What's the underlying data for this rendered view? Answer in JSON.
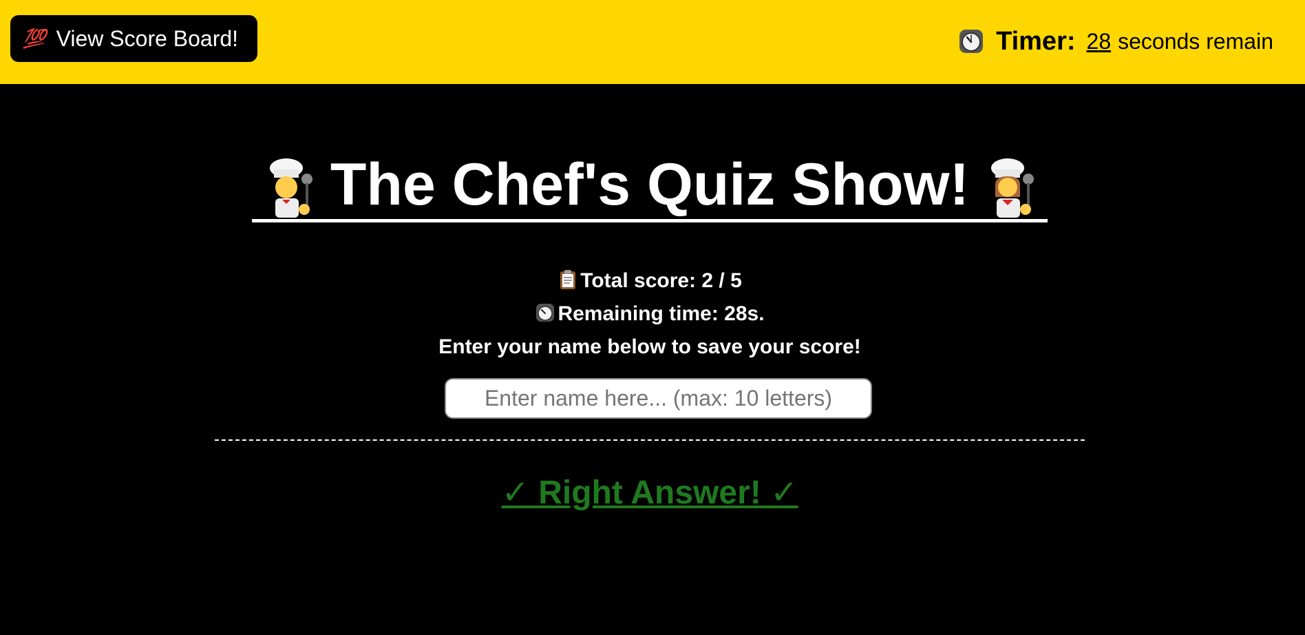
{
  "header": {
    "scoreboard_icon": "💯",
    "scoreboard_label": "View Score Board!",
    "timer_icon": "clock-icon",
    "timer_label": "Timer:",
    "timer_seconds": "28",
    "timer_suffix": "seconds remain",
    "background_color": "#FFD700"
  },
  "main": {
    "title": "The Chef's Quiz Show!",
    "title_icons": [
      "man-cook-icon",
      "woman-cook-icon"
    ],
    "score_icon": "clipboard-icon",
    "score_text": "Total score: 2 / 5",
    "time_icon": "clock-icon",
    "time_text": "Remaining time: 28s.",
    "prompt_text": "Enter your name below to save your score!",
    "name_input": {
      "value": "",
      "placeholder": "Enter name here... (max: 10 letters)"
    },
    "feedback_text": "✓ Right Answer! ✓",
    "feedback_color": "#1f7a1f"
  }
}
